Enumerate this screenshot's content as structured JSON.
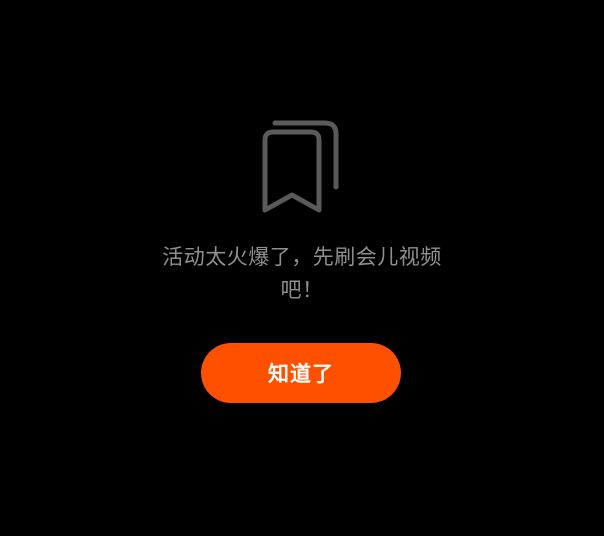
{
  "dialog": {
    "icon": "bookmarks-icon",
    "message": "活动太火爆了，先刷会儿视频吧！",
    "button_label": "知道了"
  },
  "colors": {
    "background": "#000000",
    "icon_stroke": "#5a5a5a",
    "message_text": "#8f8f8f",
    "button_bg": "#ff5000",
    "button_text": "#ffffff"
  }
}
